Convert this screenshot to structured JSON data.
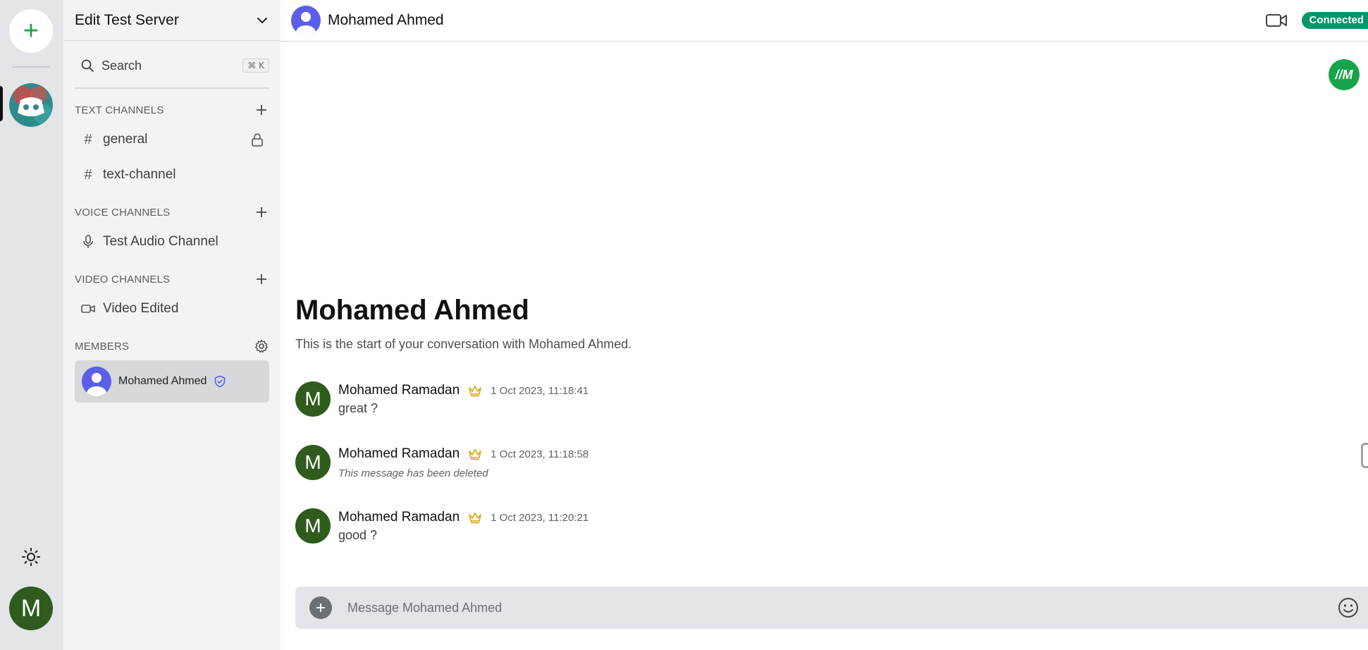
{
  "rail": {
    "add_label": "+",
    "user_avatar_letter": "M"
  },
  "server": {
    "name": "Edit Test Server"
  },
  "search": {
    "label": "Search",
    "shortcut": "⌘ K"
  },
  "sections": {
    "text": {
      "title": "TEXT CHANNELS"
    },
    "voice": {
      "title": "VOICE CHANNELS"
    },
    "video": {
      "title": "VIDEO CHANNELS"
    },
    "members": {
      "title": "MEMBERS"
    }
  },
  "channels": {
    "text": [
      {
        "name": "general",
        "icon": "hash-icon",
        "locked": true
      },
      {
        "name": "text-channel",
        "icon": "hash-icon",
        "locked": false
      }
    ],
    "voice": [
      {
        "name": "Test Audio Channel",
        "icon": "mic-icon"
      }
    ],
    "video": [
      {
        "name": "Video Edited",
        "icon": "video-icon"
      }
    ]
  },
  "members": [
    {
      "name": "Mohamed Ahmed",
      "badge": "shield-check-icon"
    }
  ],
  "conversation": {
    "name": "Mohamed Ahmed",
    "status": "Connected",
    "float_badge": "//M",
    "welcome_title": "Mohamed Ahmed",
    "welcome_sub": "This is the start of your conversation with Mohamed Ahmed."
  },
  "messages": [
    {
      "avatar": "M",
      "author": "Mohamed Ramadan",
      "time": "1 Oct 2023, 11:18:41",
      "body": "great ?",
      "deleted": false
    },
    {
      "avatar": "M",
      "author": "Mohamed Ramadan",
      "time": "1 Oct 2023, 11:18:58",
      "body": "This message has been deleted",
      "deleted": true
    },
    {
      "avatar": "M",
      "author": "Mohamed Ramadan",
      "time": "1 Oct 2023, 11:20:21",
      "body": "good ?",
      "deleted": false
    }
  ],
  "composer": {
    "placeholder": "Message Mohamed Ahmed"
  },
  "colors": {
    "accent_green": "#059669",
    "avatar_green": "#2f5c1c",
    "avatar_blue": "#5b5ee8",
    "crown_gold": "#e0a100"
  }
}
